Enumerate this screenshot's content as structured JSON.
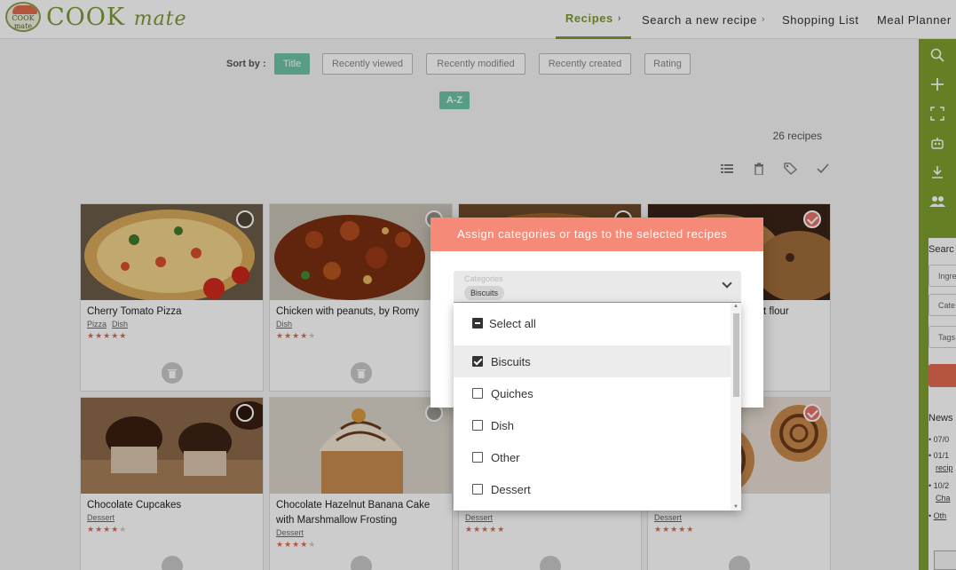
{
  "brand": {
    "name_a": "COOK",
    "name_b": "mate",
    "logo_text": "COOK mate"
  },
  "nav": {
    "recipes": "Recipes",
    "search": "Search a new recipe",
    "shopping": "Shopping List",
    "planner": "Meal Planner"
  },
  "sort": {
    "label": "Sort by :",
    "options": [
      "Title",
      "Recently viewed",
      "Recently modified",
      "Recently created",
      "Rating"
    ],
    "order": "A-Z"
  },
  "recipe_count": "26 recipes",
  "toolbar_icons": [
    "list-icon",
    "trash-icon",
    "tag-icon",
    "check-icon"
  ],
  "recipes": [
    {
      "title": "Cherry Tomato Pizza",
      "tags": [
        "Pizza",
        "Dish"
      ],
      "rating": 5,
      "selected": false
    },
    {
      "title": "Chicken with peanuts, by Romy",
      "tags": [
        "Dish"
      ],
      "rating": 4,
      "selected": false
    },
    {
      "title": "",
      "tags": [],
      "rating": 0,
      "selected": false
    },
    {
      "title": "t flour",
      "tags": [],
      "rating": 0,
      "selected": true
    },
    {
      "title": "Chocolate Cupcakes",
      "tags": [
        "Dessert"
      ],
      "rating": 4,
      "selected": false
    },
    {
      "title": "Chocolate Hazelnut Banana Cake with Marshmallow Frosting",
      "tags": [
        "Dessert"
      ],
      "rating": 4,
      "selected": false
    },
    {
      "title": "",
      "tags": [
        "Dessert"
      ],
      "rating": 5,
      "selected": false
    },
    {
      "title": "",
      "tags": [
        "Dessert"
      ],
      "rating": 5,
      "selected": true
    }
  ],
  "sidebar": {
    "search_label": "Searc",
    "field_ingredients": "Ingre",
    "field_categories": "Cate",
    "field_tags": "Tags",
    "news_label": "News",
    "news_items": [
      "07/0",
      "01/1",
      "recip",
      "10/2",
      "Cha",
      "Oth"
    ]
  },
  "modal": {
    "title": "Assign categories or tags to the selected recipes",
    "select_placeholder": "Categories",
    "selected_chip": "Biscuits",
    "options": [
      {
        "label": "Select all",
        "state": "indeterminate"
      },
      {
        "label": "Biscuits",
        "state": "checked"
      },
      {
        "label": "Quiches",
        "state": "unchecked"
      },
      {
        "label": "Dish",
        "state": "unchecked"
      },
      {
        "label": "Other",
        "state": "unchecked"
      },
      {
        "label": "Dessert",
        "state": "unchecked"
      }
    ]
  },
  "colors": {
    "brand_green": "#7fa02e",
    "accent_teal": "#6fc3a7",
    "modal_header": "#f58a78",
    "star": "#e36a4f"
  }
}
